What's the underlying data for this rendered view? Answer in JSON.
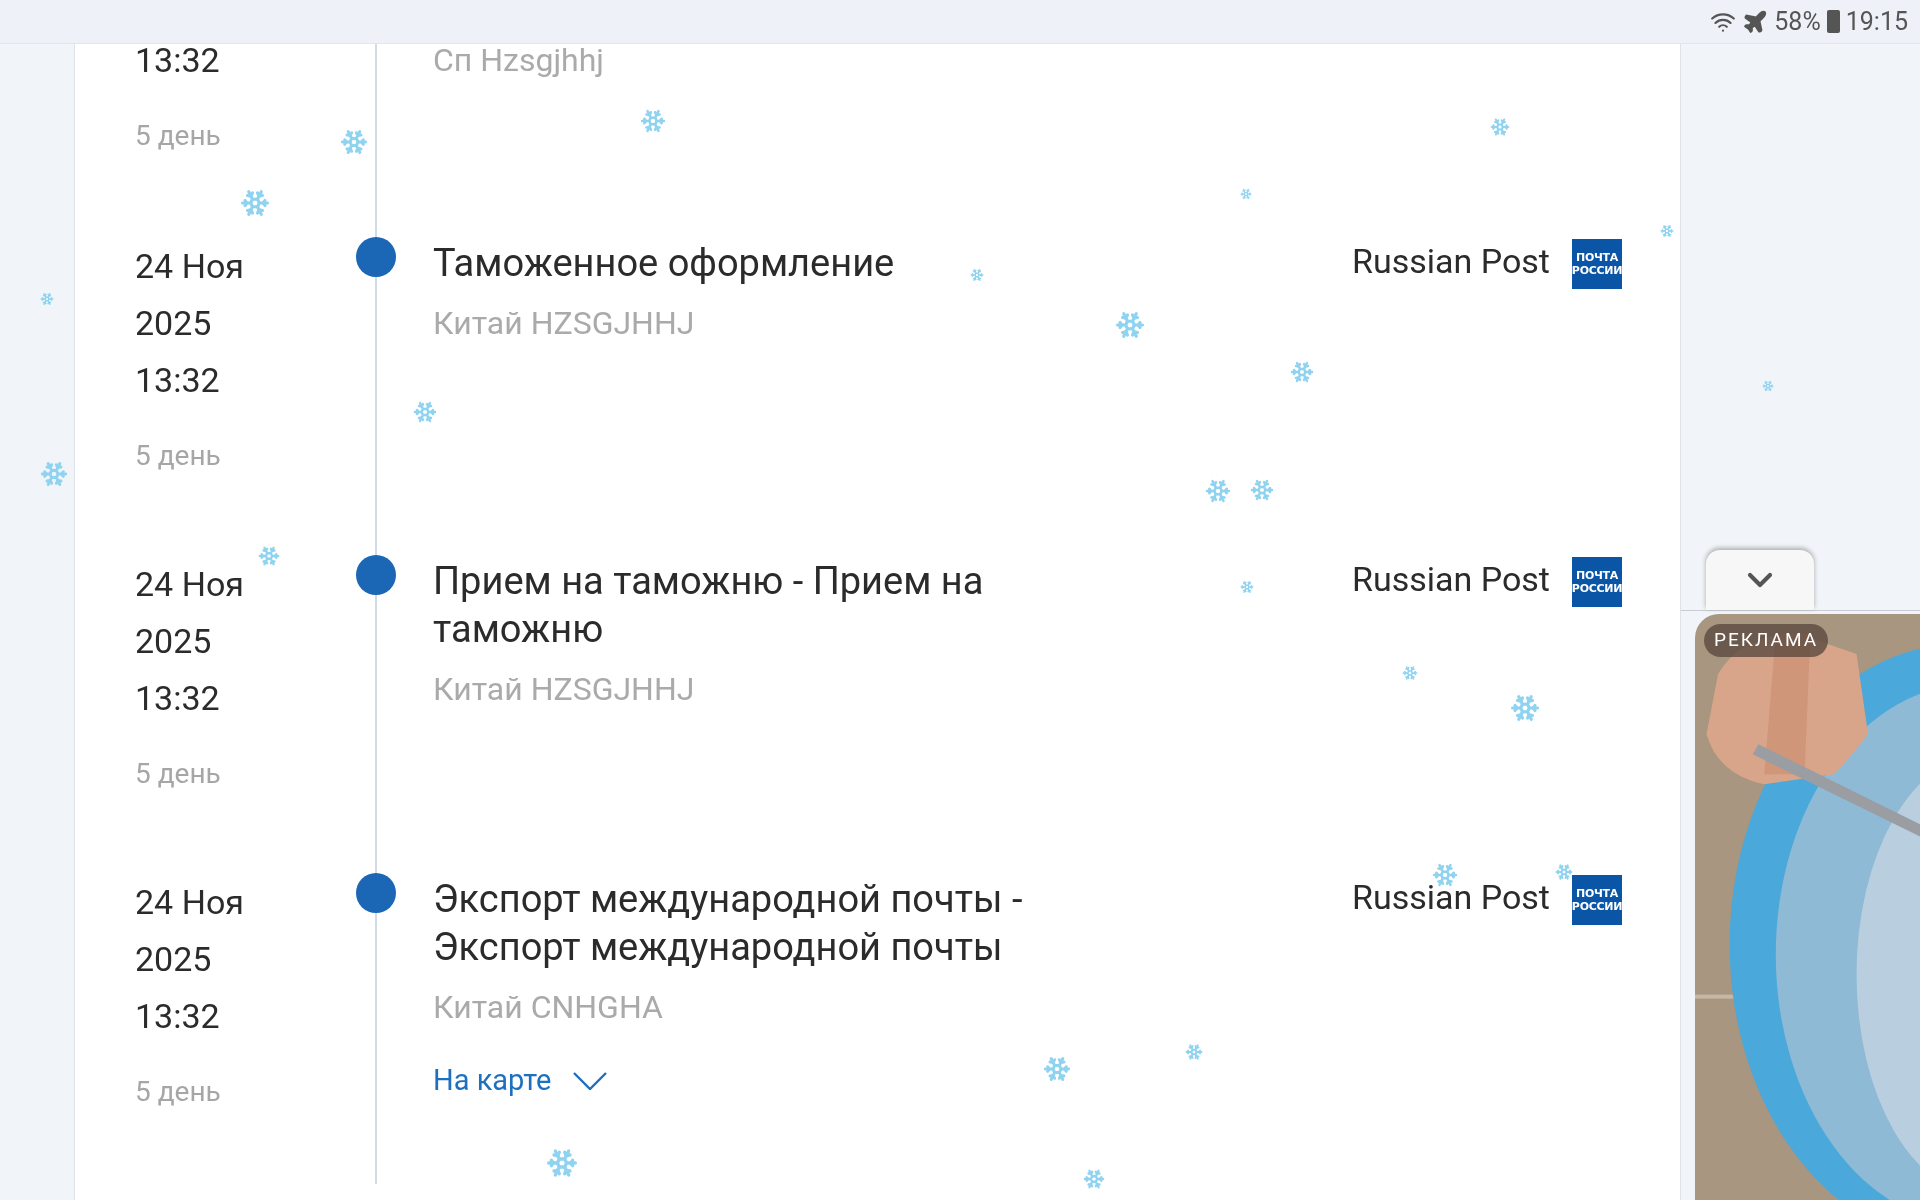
{
  "status_bar": {
    "battery": "58%",
    "time": "19:15"
  },
  "events": [
    {
      "time": "13:32",
      "age": "5 день",
      "location": "Сп Hzsgjhhj"
    },
    {
      "date": "24 Ноя",
      "year": "2025",
      "time": "13:32",
      "age": "5 день",
      "title": "Таможенное оформление",
      "location": "Китай HZSGJHHJ",
      "carrier": "Russian Post",
      "logo": [
        "ПОЧТА",
        "РОССИИ"
      ]
    },
    {
      "date": "24 Ноя",
      "year": "2025",
      "time": "13:32",
      "age": "5 день",
      "title": "Прием на таможню - Прием на таможню",
      "location": "Китай HZSGJHHJ",
      "carrier": "Russian Post",
      "logo": [
        "ПОЧТА",
        "РОССИИ"
      ]
    },
    {
      "date": "24 Ноя",
      "year": "2025",
      "time": "13:32",
      "age": "5 день",
      "title": "Экспорт международной почты - Экспорт международной почты",
      "location": "Китай CNHGHA",
      "carrier": "Russian Post",
      "logo": [
        "ПОЧТА",
        "РОССИИ"
      ],
      "map_link": "На карте"
    }
  ],
  "ad": {
    "label": "РЕКЛАМА"
  }
}
